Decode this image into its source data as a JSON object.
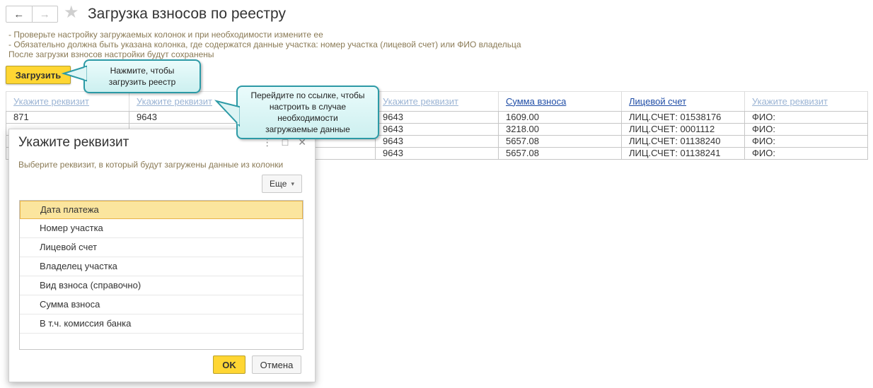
{
  "header": {
    "back_icon": "←",
    "forward_icon": "→",
    "favorite_icon": "★",
    "title": "Загрузка взносов по реестру"
  },
  "hints": [
    "- Проверьте настройку загружаемых колонок и при необходимости измените ее",
    "- Обязательно должна быть указана колонка, где содержатся данные участка: номер участка (лицевой счет) или ФИО владельца",
    "После загрузки взносов настройки будут сохранены"
  ],
  "load_button": "Загрузить",
  "tooltips": {
    "load": [
      "Нажмите, чтобы",
      "загрузить реестр"
    ],
    "link": [
      "Перейдите по ссылке, чтобы",
      "настроить в случае",
      "необходимости",
      "загружаемые данные"
    ]
  },
  "table": {
    "headers": [
      "Укажите реквизит",
      "Укажите реквизит",
      "",
      "Укажите реквизит",
      "Сумма взноса",
      "Лицевой счет",
      "Укажите реквизит"
    ],
    "rows": [
      [
        "871",
        "9643",
        "",
        "9643",
        "1609.00",
        "ЛИЦ.СЧЕТ: 01538176",
        "ФИО:"
      ],
      [
        "",
        "",
        "",
        "9643",
        "3218.00",
        "ЛИЦ.СЧЕТ: 0001112",
        "ФИО:"
      ],
      [
        "",
        "",
        "",
        "9643",
        "5657.08",
        "ЛИЦ.СЧЕТ: 01138240",
        "ФИО:"
      ],
      [
        "",
        "",
        "",
        "9643",
        "5657.08",
        "ЛИЦ.СЧЕТ: 01138241",
        "ФИО:"
      ]
    ]
  },
  "dialog": {
    "title": "Укажите реквизит",
    "menu_icon": "⋮",
    "maximize_icon": "□",
    "close_icon": "✕",
    "subtitle": "Выберите реквизит, в который будут загружены данные из колонки",
    "more_button": "Еще",
    "more_arrow": "▾",
    "items": [
      "Дата платежа",
      "Номер участка",
      "Лицевой счет",
      "Владелец участка",
      "Вид взноса (справочно)",
      "Сумма взноса",
      "В т.ч. комиссия банка"
    ],
    "ok": "OK",
    "cancel": "Отмена"
  }
}
